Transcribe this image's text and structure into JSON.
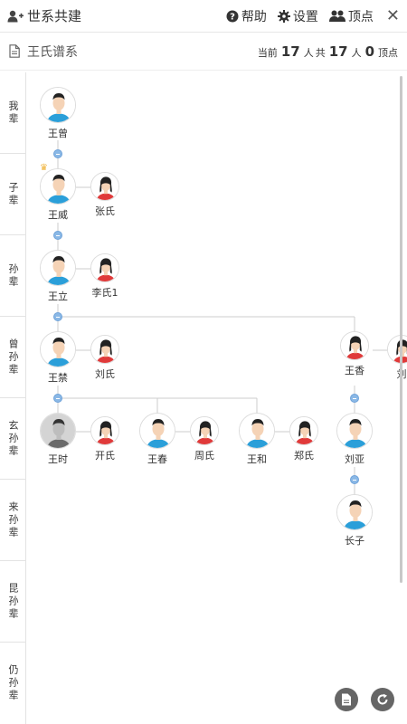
{
  "header": {
    "title": "世系共建",
    "help_label": "帮助",
    "settings_label": "设置",
    "top_label": "顶点",
    "close_label": "✕"
  },
  "subheader": {
    "doc_title": "王氏谱系",
    "current_prefix": "当前",
    "current_count": "17",
    "unit1": "人",
    "total_prefix": "共",
    "total_count": "17",
    "unit2": "人",
    "vertex_count": "0",
    "vertex_label": "顶点"
  },
  "generations": [
    "我辈",
    "子辈",
    "孙辈",
    "曾孙辈",
    "玄孙辈",
    "来孙辈",
    "昆孙辈",
    "仍孙辈"
  ],
  "people": [
    {
      "name": "王曾",
      "gender": "male"
    },
    {
      "name": "王威",
      "gender": "male"
    },
    {
      "name": "张氏",
      "gender": "female"
    },
    {
      "name": "王立",
      "gender": "male"
    },
    {
      "name": "李氏1",
      "gender": "female"
    },
    {
      "name": "王禁",
      "gender": "male"
    },
    {
      "name": "刘氏",
      "gender": "female"
    },
    {
      "name": "王香",
      "gender": "female"
    },
    {
      "name": "刘",
      "gender": "female"
    },
    {
      "name": "王时",
      "gender": "male_gray"
    },
    {
      "name": "开氏",
      "gender": "female"
    },
    {
      "name": "王春",
      "gender": "male"
    },
    {
      "name": "周氏",
      "gender": "female"
    },
    {
      "name": "王和",
      "gender": "male"
    },
    {
      "name": "郑氏",
      "gender": "female"
    },
    {
      "name": "刘亚",
      "gender": "male"
    },
    {
      "name": "长子",
      "gender": "male"
    }
  ],
  "colors": {
    "accent": "#8ab8e6",
    "male_shirt": "#2b9fd9",
    "female_shirt": "#e03a3a",
    "line": "#cccccc"
  }
}
